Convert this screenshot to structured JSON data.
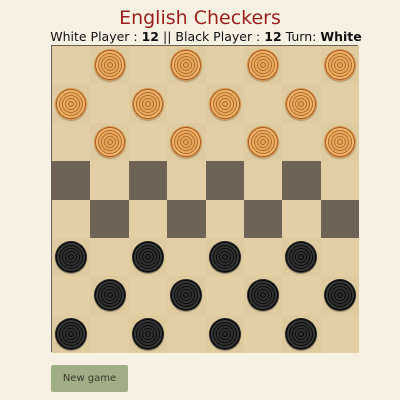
{
  "title": "English Checkers",
  "status": {
    "white_label": "White Player : ",
    "white_count": "12",
    "separator": " || ",
    "black_label": "Black Player : ",
    "black_count": "12",
    "turn_label": " Turn: ",
    "turn_value": "White"
  },
  "board": {
    "size": 8,
    "colors": {
      "light": "#e2cfa5",
      "dark": "#6f6358",
      "white_piece": "#e6a85e",
      "black_piece": "#1a1a1a"
    },
    "pieces": [
      {
        "row": 0,
        "col": 1,
        "color": "white"
      },
      {
        "row": 0,
        "col": 3,
        "color": "white"
      },
      {
        "row": 0,
        "col": 5,
        "color": "white"
      },
      {
        "row": 0,
        "col": 7,
        "color": "white"
      },
      {
        "row": 1,
        "col": 0,
        "color": "white"
      },
      {
        "row": 1,
        "col": 2,
        "color": "white"
      },
      {
        "row": 1,
        "col": 4,
        "color": "white"
      },
      {
        "row": 1,
        "col": 6,
        "color": "white"
      },
      {
        "row": 2,
        "col": 1,
        "color": "white"
      },
      {
        "row": 2,
        "col": 3,
        "color": "white"
      },
      {
        "row": 2,
        "col": 5,
        "color": "white"
      },
      {
        "row": 2,
        "col": 7,
        "color": "white"
      },
      {
        "row": 5,
        "col": 0,
        "color": "black"
      },
      {
        "row": 5,
        "col": 2,
        "color": "black"
      },
      {
        "row": 5,
        "col": 4,
        "color": "black"
      },
      {
        "row": 5,
        "col": 6,
        "color": "black"
      },
      {
        "row": 6,
        "col": 1,
        "color": "black"
      },
      {
        "row": 6,
        "col": 3,
        "color": "black"
      },
      {
        "row": 6,
        "col": 5,
        "color": "black"
      },
      {
        "row": 6,
        "col": 7,
        "color": "black"
      },
      {
        "row": 7,
        "col": 0,
        "color": "black"
      },
      {
        "row": 7,
        "col": 2,
        "color": "black"
      },
      {
        "row": 7,
        "col": 4,
        "color": "black"
      },
      {
        "row": 7,
        "col": 6,
        "color": "black"
      }
    ]
  },
  "new_game_label": "New game"
}
